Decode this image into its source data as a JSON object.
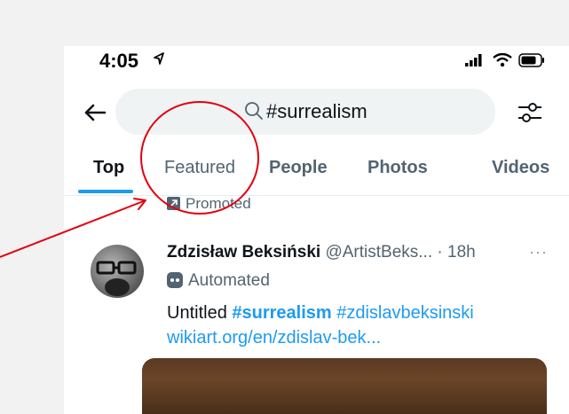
{
  "status": {
    "time": "4:05"
  },
  "search": {
    "query": "#surrealism"
  },
  "tabs": [
    {
      "label": "Top"
    },
    {
      "label": "Featured"
    },
    {
      "label": "People"
    },
    {
      "label": "Photos"
    },
    {
      "label": "Videos"
    }
  ],
  "promoted": {
    "label": "Promoted"
  },
  "tweet": {
    "name": "Zdzisław Beksiński",
    "handle": "@ArtistBeks...",
    "time": "· 18h",
    "automated": "Automated",
    "text_prefix": "Untitled ",
    "hashtag_bold": "#surrealism",
    "hashtag2": " #zdislavbeksinski",
    "link": "wikiart.org/en/zdislav-bek..."
  },
  "colors": {
    "accent": "#1d9bf0",
    "annotation": "#e3000f"
  },
  "icons": [
    "location-arrow-icon",
    "signal-icon",
    "wifi-icon",
    "battery-icon",
    "back-arrow-icon",
    "search-icon",
    "filters-icon",
    "promoted-icon",
    "robot-icon",
    "more-icon"
  ]
}
